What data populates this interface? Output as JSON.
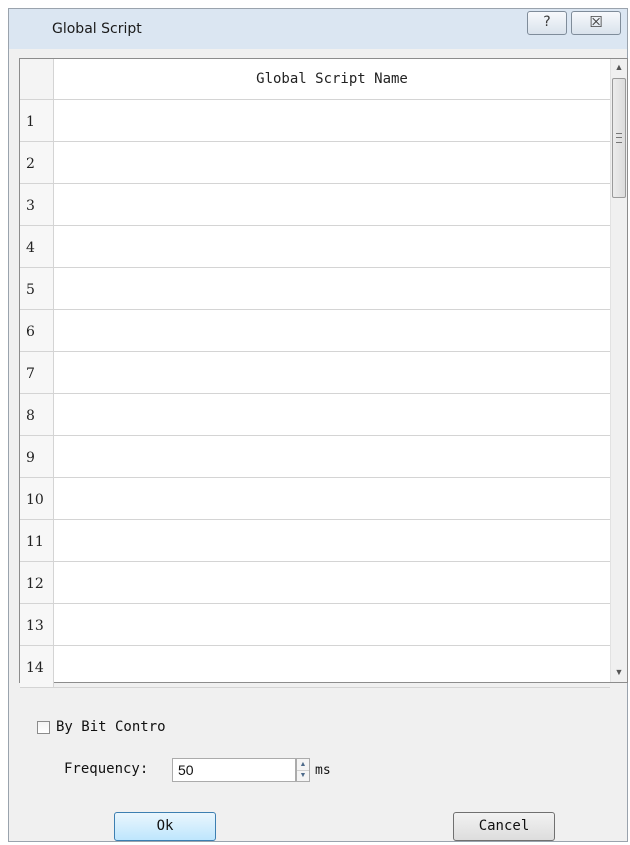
{
  "window": {
    "title": "Global Script",
    "help_glyph": "?",
    "close_glyph": "☒"
  },
  "table": {
    "column_header": "Global Script Name",
    "rows": [
      {
        "num": "1",
        "name": ""
      },
      {
        "num": "2",
        "name": ""
      },
      {
        "num": "3",
        "name": ""
      },
      {
        "num": "4",
        "name": ""
      },
      {
        "num": "5",
        "name": ""
      },
      {
        "num": "6",
        "name": ""
      },
      {
        "num": "7",
        "name": ""
      },
      {
        "num": "8",
        "name": ""
      },
      {
        "num": "9",
        "name": ""
      },
      {
        "num": "10",
        "name": ""
      },
      {
        "num": "11",
        "name": ""
      },
      {
        "num": "12",
        "name": ""
      },
      {
        "num": "13",
        "name": ""
      },
      {
        "num": "14",
        "name": ""
      }
    ],
    "scroll_up_glyph": "▲",
    "scroll_down_glyph": "▼"
  },
  "options": {
    "bit_control_label": "By Bit Contro",
    "bit_control_checked": false,
    "frequency_label": "Frequency:",
    "frequency_value": "50",
    "frequency_unit": "ms",
    "spin_up_glyph": "▲",
    "spin_down_glyph": "▼"
  },
  "buttons": {
    "ok": "Ok",
    "cancel": "Cancel"
  },
  "colors": {
    "titlebar": "#dbe6f2",
    "ok_border": "#3c7fb1"
  }
}
